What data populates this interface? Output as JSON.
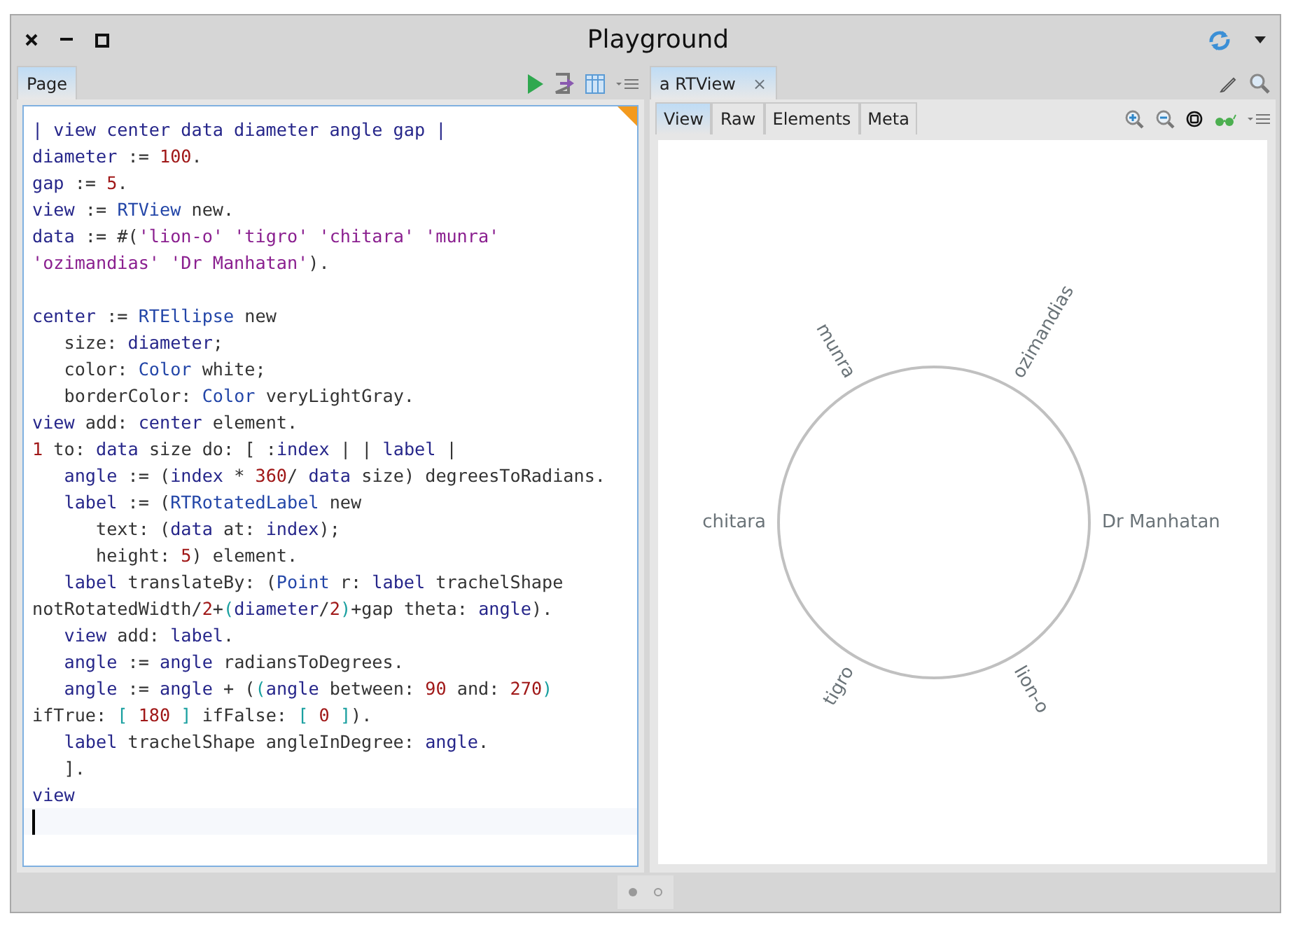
{
  "window": {
    "title": "Playground"
  },
  "left_pane": {
    "tabs": [
      {
        "label": "Page",
        "selected": true
      }
    ],
    "code_lines": [
      {
        "kind": "code",
        "tokens": [
          {
            "text": "| view center data diameter angle gap |",
            "kind": "var"
          }
        ]
      },
      {
        "kind": "code",
        "tokens": [
          {
            "text": "diameter",
            "kind": "var"
          },
          {
            "text": " := ",
            "kind": "plain"
          },
          {
            "text": "100",
            "kind": "num"
          },
          {
            "text": ".",
            "kind": "plain"
          }
        ]
      },
      {
        "kind": "code",
        "tokens": [
          {
            "text": "gap",
            "kind": "var"
          },
          {
            "text": " := ",
            "kind": "plain"
          },
          {
            "text": "5",
            "kind": "num"
          },
          {
            "text": ".",
            "kind": "plain"
          }
        ]
      },
      {
        "kind": "code",
        "tokens": [
          {
            "text": "view",
            "kind": "var"
          },
          {
            "text": " := ",
            "kind": "plain"
          },
          {
            "text": "RTView",
            "kind": "class"
          },
          {
            "text": " new.",
            "kind": "plain"
          }
        ]
      },
      {
        "kind": "code",
        "tokens": [
          {
            "text": "data",
            "kind": "var"
          },
          {
            "text": " := #(",
            "kind": "plain"
          },
          {
            "text": "'lion-o' 'tigro' 'chitara' 'munra'",
            "kind": "str"
          }
        ]
      },
      {
        "kind": "code",
        "tokens": [
          {
            "text": "'ozimandias' 'Dr Manhatan'",
            "kind": "str"
          },
          {
            "text": ").",
            "kind": "plain"
          }
        ]
      },
      {
        "kind": "blank"
      },
      {
        "kind": "code",
        "tokens": [
          {
            "text": "center",
            "kind": "var"
          },
          {
            "text": " := ",
            "kind": "plain"
          },
          {
            "text": "RTEllipse",
            "kind": "class"
          },
          {
            "text": " new",
            "kind": "plain"
          }
        ]
      },
      {
        "kind": "code",
        "tokens": [
          {
            "text": "   size: ",
            "kind": "plain"
          },
          {
            "text": "diameter",
            "kind": "var"
          },
          {
            "text": ";",
            "kind": "plain"
          }
        ]
      },
      {
        "kind": "code",
        "tokens": [
          {
            "text": "   color: ",
            "kind": "plain"
          },
          {
            "text": "Color",
            "kind": "class"
          },
          {
            "text": " white;",
            "kind": "plain"
          }
        ]
      },
      {
        "kind": "code",
        "tokens": [
          {
            "text": "   borderColor: ",
            "kind": "plain"
          },
          {
            "text": "Color",
            "kind": "class"
          },
          {
            "text": " veryLightGray.",
            "kind": "plain"
          }
        ]
      },
      {
        "kind": "code",
        "tokens": [
          {
            "text": "view",
            "kind": "var"
          },
          {
            "text": " add: ",
            "kind": "plain"
          },
          {
            "text": "center",
            "kind": "var"
          },
          {
            "text": " element.",
            "kind": "plain"
          }
        ]
      },
      {
        "kind": "code",
        "tokens": [
          {
            "text": "1",
            "kind": "num"
          },
          {
            "text": " to: ",
            "kind": "plain"
          },
          {
            "text": "data",
            "kind": "var"
          },
          {
            "text": " size do: [ :",
            "kind": "plain"
          },
          {
            "text": "index",
            "kind": "var"
          },
          {
            "text": " | | ",
            "kind": "plain"
          },
          {
            "text": "label",
            "kind": "var"
          },
          {
            "text": " |",
            "kind": "plain"
          }
        ]
      },
      {
        "kind": "code",
        "tokens": [
          {
            "text": "   angle",
            "kind": "var"
          },
          {
            "text": " := (",
            "kind": "plain"
          },
          {
            "text": "index",
            "kind": "var"
          },
          {
            "text": " * ",
            "kind": "plain"
          },
          {
            "text": "360",
            "kind": "num"
          },
          {
            "text": "/ ",
            "kind": "plain"
          },
          {
            "text": "data",
            "kind": "var"
          },
          {
            "text": " size) degreesToRadians.",
            "kind": "plain"
          }
        ]
      },
      {
        "kind": "code",
        "tokens": [
          {
            "text": "   label",
            "kind": "var"
          },
          {
            "text": " := (",
            "kind": "plain"
          },
          {
            "text": "RTRotatedLabel",
            "kind": "class"
          },
          {
            "text": " new",
            "kind": "plain"
          }
        ]
      },
      {
        "kind": "code",
        "tokens": [
          {
            "text": "      text: (",
            "kind": "plain"
          },
          {
            "text": "data",
            "kind": "var"
          },
          {
            "text": " at: ",
            "kind": "plain"
          },
          {
            "text": "index",
            "kind": "var"
          },
          {
            "text": ");",
            "kind": "plain"
          }
        ]
      },
      {
        "kind": "code",
        "tokens": [
          {
            "text": "      height: ",
            "kind": "plain"
          },
          {
            "text": "5",
            "kind": "num"
          },
          {
            "text": ") element.",
            "kind": "plain"
          }
        ]
      },
      {
        "kind": "code",
        "tokens": [
          {
            "text": "   label",
            "kind": "var"
          },
          {
            "text": " translateBy: (",
            "kind": "plain"
          },
          {
            "text": "Point",
            "kind": "class"
          },
          {
            "text": " r: ",
            "kind": "plain"
          },
          {
            "text": "label",
            "kind": "var"
          },
          {
            "text": " trachelShape",
            "kind": "plain"
          }
        ]
      },
      {
        "kind": "code",
        "tokens": [
          {
            "text": "notRotatedWidth/",
            "kind": "plain"
          },
          {
            "text": "2",
            "kind": "num"
          },
          {
            "text": "+",
            "kind": "plain"
          },
          {
            "text": "(",
            "kind": "bracket"
          },
          {
            "text": "diameter",
            "kind": "var"
          },
          {
            "text": "/",
            "kind": "plain"
          },
          {
            "text": "2",
            "kind": "num"
          },
          {
            "text": ")",
            "kind": "bracket"
          },
          {
            "text": "+gap theta: ",
            "kind": "plain"
          },
          {
            "text": "angle",
            "kind": "var"
          },
          {
            "text": ").",
            "kind": "plain"
          }
        ]
      },
      {
        "kind": "code",
        "tokens": [
          {
            "text": "   view",
            "kind": "var"
          },
          {
            "text": " add: ",
            "kind": "plain"
          },
          {
            "text": "label",
            "kind": "var"
          },
          {
            "text": ".",
            "kind": "plain"
          }
        ]
      },
      {
        "kind": "code",
        "tokens": [
          {
            "text": "   angle",
            "kind": "var"
          },
          {
            "text": " := ",
            "kind": "plain"
          },
          {
            "text": "angle",
            "kind": "var"
          },
          {
            "text": " radiansToDegrees.",
            "kind": "plain"
          }
        ]
      },
      {
        "kind": "code",
        "tokens": [
          {
            "text": "   angle",
            "kind": "var"
          },
          {
            "text": " := ",
            "kind": "plain"
          },
          {
            "text": "angle",
            "kind": "var"
          },
          {
            "text": " + (",
            "kind": "plain"
          },
          {
            "text": "(",
            "kind": "bracket"
          },
          {
            "text": "angle",
            "kind": "var"
          },
          {
            "text": " between: ",
            "kind": "plain"
          },
          {
            "text": "90",
            "kind": "num"
          },
          {
            "text": " and: ",
            "kind": "plain"
          },
          {
            "text": "270",
            "kind": "num"
          },
          {
            "text": ")",
            "kind": "bracket"
          }
        ]
      },
      {
        "kind": "code",
        "tokens": [
          {
            "text": "ifTrue: ",
            "kind": "plain"
          },
          {
            "text": "[ ",
            "kind": "bracket"
          },
          {
            "text": "180",
            "kind": "num"
          },
          {
            "text": " ]",
            "kind": "bracket"
          },
          {
            "text": " ifFalse: ",
            "kind": "plain"
          },
          {
            "text": "[ ",
            "kind": "bracket"
          },
          {
            "text": "0",
            "kind": "num"
          },
          {
            "text": " ]",
            "kind": "bracket"
          },
          {
            "text": ").",
            "kind": "plain"
          }
        ]
      },
      {
        "kind": "code",
        "tokens": [
          {
            "text": "   label",
            "kind": "var"
          },
          {
            "text": " trachelShape angleInDegree: ",
            "kind": "plain"
          },
          {
            "text": "angle",
            "kind": "var"
          },
          {
            "text": ".",
            "kind": "plain"
          }
        ]
      },
      {
        "kind": "code",
        "tokens": [
          {
            "text": "   ].",
            "kind": "plain"
          }
        ]
      },
      {
        "kind": "code",
        "tokens": [
          {
            "text": "view",
            "kind": "var"
          }
        ]
      },
      {
        "kind": "cursor"
      }
    ]
  },
  "right_pane": {
    "tabs": [
      {
        "label": "a RTView",
        "selected": true,
        "close": "×"
      }
    ],
    "sub_tabs": [
      {
        "label": "View",
        "selected": true
      },
      {
        "label": "Raw",
        "selected": false
      },
      {
        "label": "Elements",
        "selected": false
      },
      {
        "label": "Meta",
        "selected": false
      }
    ],
    "diagram": {
      "labels": [
        "lion-o",
        "tigro",
        "chitara",
        "munra",
        "ozimandias",
        "Dr Manhatan"
      ]
    }
  },
  "pager": [
    {
      "selected": true
    },
    {
      "selected": false
    }
  ]
}
